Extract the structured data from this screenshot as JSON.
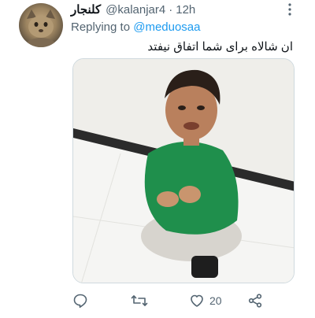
{
  "tweet": {
    "display_name": "کلنجار",
    "handle": "@kalanjar4",
    "separator": "·",
    "time": "12h",
    "replying_prefix": "Replying to",
    "replying_to": "@meduosaa",
    "text": "ان شالاه برای شما اتفاق نیفتد"
  },
  "actions": {
    "reply_icon": "reply-icon",
    "retweet_icon": "retweet-icon",
    "like_icon": "heart-icon",
    "like_count": "20",
    "share_icon": "share-icon"
  },
  "colors": {
    "text": "#0f1419",
    "secondary": "#536471",
    "link": "#1d9bf0",
    "border": "#cfd9de",
    "shirt": "#1f8f4c"
  }
}
